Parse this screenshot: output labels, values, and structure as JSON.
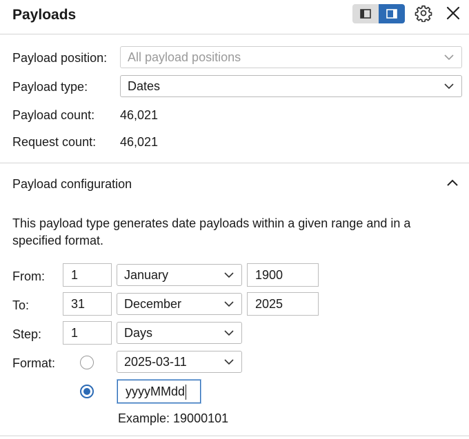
{
  "header": {
    "title": "Payloads"
  },
  "fields": {
    "position_label": "Payload position:",
    "position_value": "All payload positions",
    "type_label": "Payload type:",
    "type_value": "Dates",
    "count_label": "Payload count:",
    "count_value": "46,021",
    "request_label": "Request count:",
    "request_value": "46,021"
  },
  "config": {
    "section_title": "Payload configuration",
    "description": "This payload type generates date payloads within a given range and in a specified format.",
    "from_label": "From:",
    "from_day": "1",
    "from_month": "January",
    "from_year": "1900",
    "to_label": "To:",
    "to_day": "31",
    "to_month": "December",
    "to_year": "2025",
    "step_label": "Step:",
    "step_value": "1",
    "step_unit": "Days",
    "format_label": "Format:",
    "format_preset": "2025-03-11",
    "format_custom": "yyyyMMdd",
    "example_text": "Example: 19000101"
  },
  "colors": {
    "accent": "#2c6bb5",
    "divider": "#d4d4d4"
  }
}
